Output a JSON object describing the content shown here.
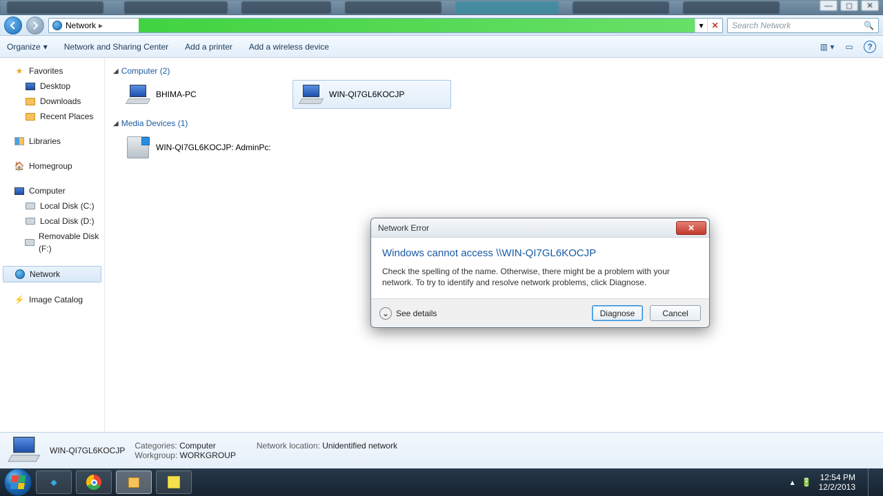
{
  "address": {
    "root": "Network",
    "crumb_sep": "▸"
  },
  "search": {
    "placeholder": "Search Network"
  },
  "toolbar": {
    "organize": "Organize",
    "items": [
      "Network and Sharing Center",
      "Add a printer",
      "Add a wireless device"
    ]
  },
  "sidebar": {
    "favorites": {
      "label": "Favorites",
      "items": [
        "Desktop",
        "Downloads",
        "Recent Places"
      ]
    },
    "libraries": {
      "label": "Libraries"
    },
    "homegroup": {
      "label": "Homegroup"
    },
    "computer": {
      "label": "Computer",
      "drives": [
        "Local Disk (C:)",
        "Local Disk (D:)",
        "Removable Disk (F:)"
      ]
    },
    "network": {
      "label": "Network"
    },
    "image_catalog": {
      "label": "Image Catalog"
    }
  },
  "content": {
    "groups": [
      {
        "header": "Computer (2)",
        "items": [
          "BHIMA-PC",
          "WIN-QI7GL6KOCJP"
        ],
        "selected_index": 1
      },
      {
        "header": "Media Devices (1)",
        "items": [
          "WIN-QI7GL6KOCJP: AdminPc:"
        ]
      }
    ]
  },
  "dialog": {
    "title": "Network Error",
    "heading": "Windows cannot access \\\\WIN-QI7GL6KOCJP",
    "message": "Check the spelling of the name. Otherwise, there might be a problem with your network. To try to identify and resolve network problems, click Diagnose.",
    "see_details": "See details",
    "diagnose": "Diagnose",
    "cancel": "Cancel"
  },
  "details": {
    "name": "WIN-QI7GL6KOCJP",
    "categories_label": "Categories:",
    "categories": "Computer",
    "workgroup_label": "Workgroup:",
    "workgroup": "WORKGROUP",
    "netloc_label": "Network location:",
    "netloc": "Unidentified network"
  },
  "tray": {
    "time": "12:54 PM",
    "date": "12/2/2013"
  }
}
